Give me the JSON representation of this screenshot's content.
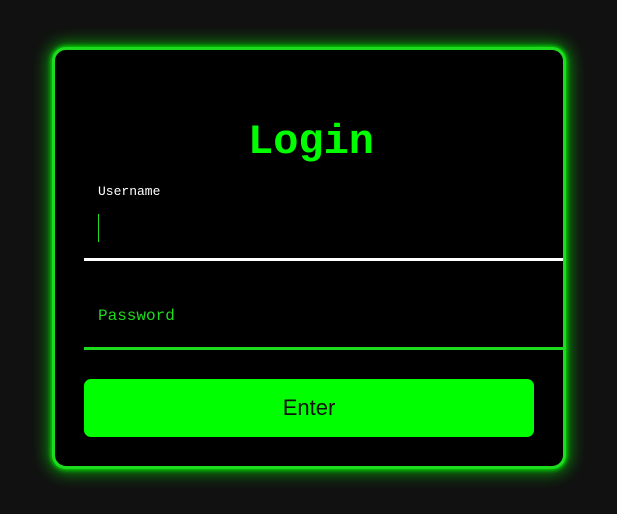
{
  "login_form": {
    "title": "Login",
    "username": {
      "label": "Username",
      "value": ""
    },
    "password": {
      "placeholder": "Password",
      "value": ""
    },
    "enter_label": "Enter"
  },
  "colors": {
    "accent": "#00ff00",
    "border": "#1ddb1d",
    "card_background": "#000000",
    "page_background": "#111111",
    "active_underline": "#ffffff",
    "button_text": "#111111"
  }
}
